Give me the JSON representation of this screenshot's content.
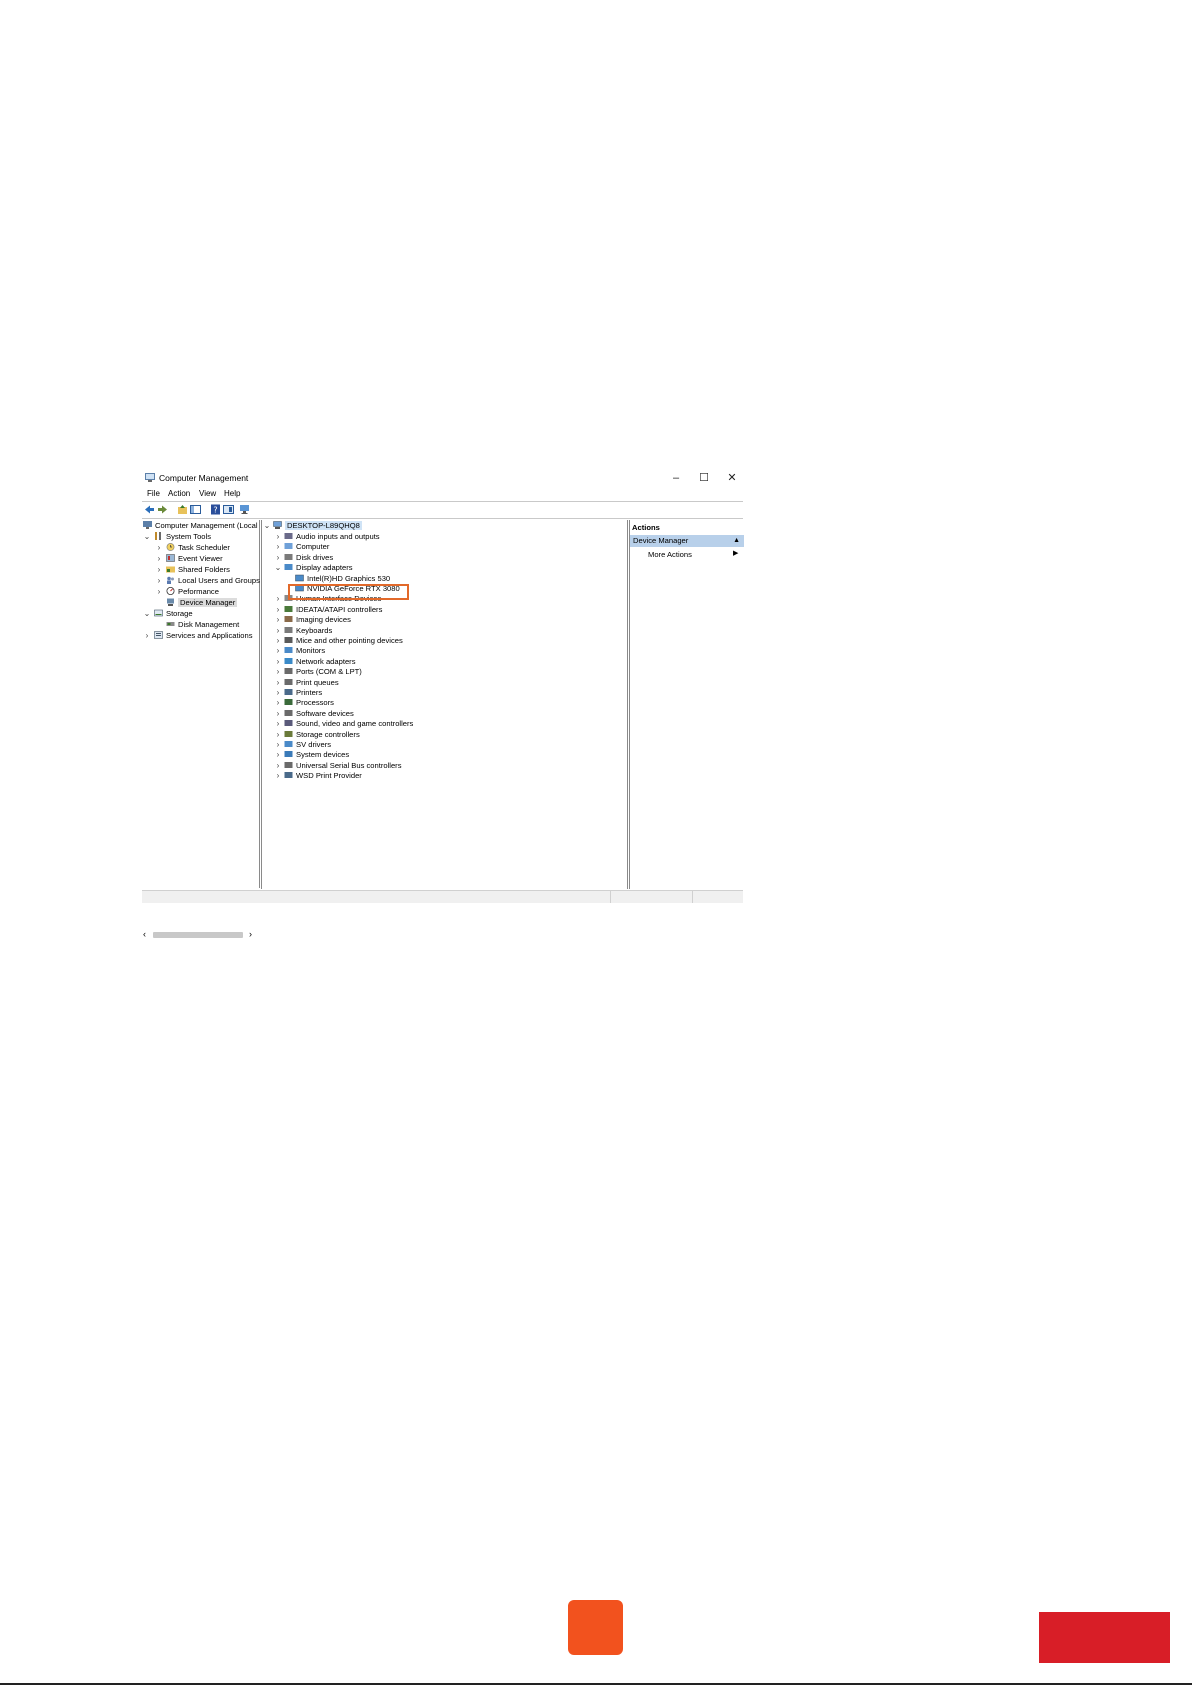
{
  "window": {
    "title": "Computer Management",
    "controls": {
      "minimize": "–",
      "maximize": "☐",
      "close": "✕"
    }
  },
  "menu": [
    "File",
    "Action",
    "View",
    "Help"
  ],
  "left_tree": {
    "root": "Computer Management (Local",
    "system_tools": "System Tools",
    "system_tools_items": [
      "Task Scheduler",
      "Event Viewer",
      "Shared Folders",
      "Local Users and Groups",
      "Peformance",
      "Device Manager"
    ],
    "storage": "Storage",
    "storage_items": [
      "Disk Management"
    ],
    "services": "Services and Applications"
  },
  "device_tree": {
    "root": "DESKTOP-L89QHQ8",
    "categories": [
      "Audio inputs and outputs",
      "Computer",
      "Disk drives",
      "Display adapters",
      "Human Interface Devices",
      "IDEATA/ATAPI controllers",
      "Imaging devices",
      "Keyboards",
      "Mice and other pointing devices",
      "Monitors",
      "Network adapters",
      "Ports (COM & LPT)",
      "Print queues",
      "Printers",
      "Processors",
      "Software devices",
      "Sound, video and game controllers",
      "Storage controllers",
      "SV drivers",
      "System devices",
      "Universal Serial Bus controllers",
      "WSD Print Provider"
    ],
    "display_children": [
      "Intel(R)HD Graphics 530",
      "NVIDIA GeForce RTX 3080"
    ]
  },
  "actions": {
    "header": "Actions",
    "section": "Device Manager",
    "more": "More Actions"
  },
  "colors": {
    "highlight": "#e2692a",
    "orange_button": "#f2521e",
    "red_bar": "#d81e27"
  }
}
